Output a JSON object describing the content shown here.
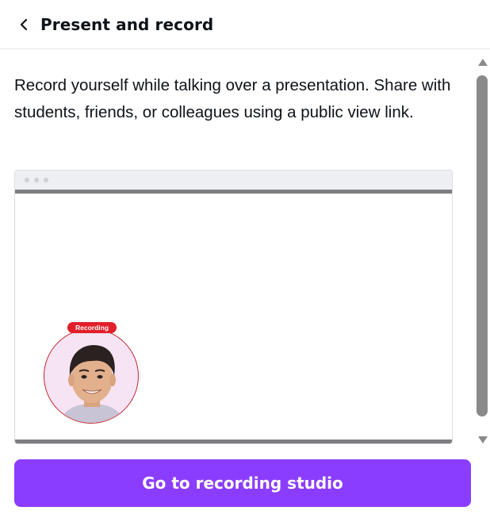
{
  "header": {
    "back_icon": "chevron-left-icon",
    "title": "Present and record"
  },
  "main": {
    "description": "Record yourself while talking over a presentation. Share with students, friends, or colleagues using a public view link.",
    "preview": {
      "badge": "Recording"
    }
  },
  "footer": {
    "primary_button": "Go to recording studio"
  },
  "colors": {
    "accent": "#8b3dff",
    "recording_red": "#e2202a"
  }
}
